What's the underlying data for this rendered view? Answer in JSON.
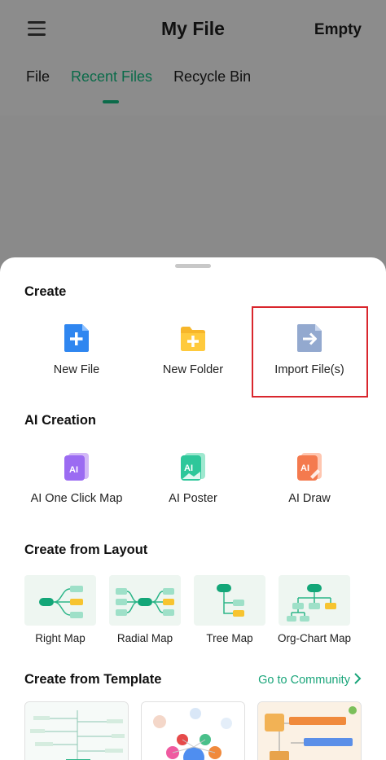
{
  "header": {
    "title": "My File",
    "action_label": "Empty",
    "tabs": [
      {
        "label": "File"
      },
      {
        "label": "Recent Files",
        "active": true
      },
      {
        "label": "Recycle Bin"
      }
    ]
  },
  "sheet": {
    "create": {
      "title": "Create",
      "items": [
        {
          "label": "New File",
          "icon": "new-file-icon"
        },
        {
          "label": "New Folder",
          "icon": "new-folder-icon"
        },
        {
          "label": "Import File(s)",
          "icon": "import-file-icon"
        }
      ]
    },
    "ai_creation": {
      "title": "AI Creation",
      "items": [
        {
          "label": "AI One Click Map",
          "icon": "ai-one-click-map-icon"
        },
        {
          "label": "AI Poster",
          "icon": "ai-poster-icon"
        },
        {
          "label": "AI Draw",
          "icon": "ai-draw-icon"
        }
      ]
    },
    "layout": {
      "title": "Create from Layout",
      "items": [
        {
          "label": "Right Map"
        },
        {
          "label": "Radial Map"
        },
        {
          "label": "Tree Map"
        },
        {
          "label": "Org-Chart Map"
        }
      ]
    },
    "template": {
      "title": "Create from Template",
      "community_link": "Go to Community"
    }
  },
  "colors": {
    "accent": "#0b6b4a",
    "link": "#1aa57a",
    "highlight_border": "#d9262d"
  }
}
